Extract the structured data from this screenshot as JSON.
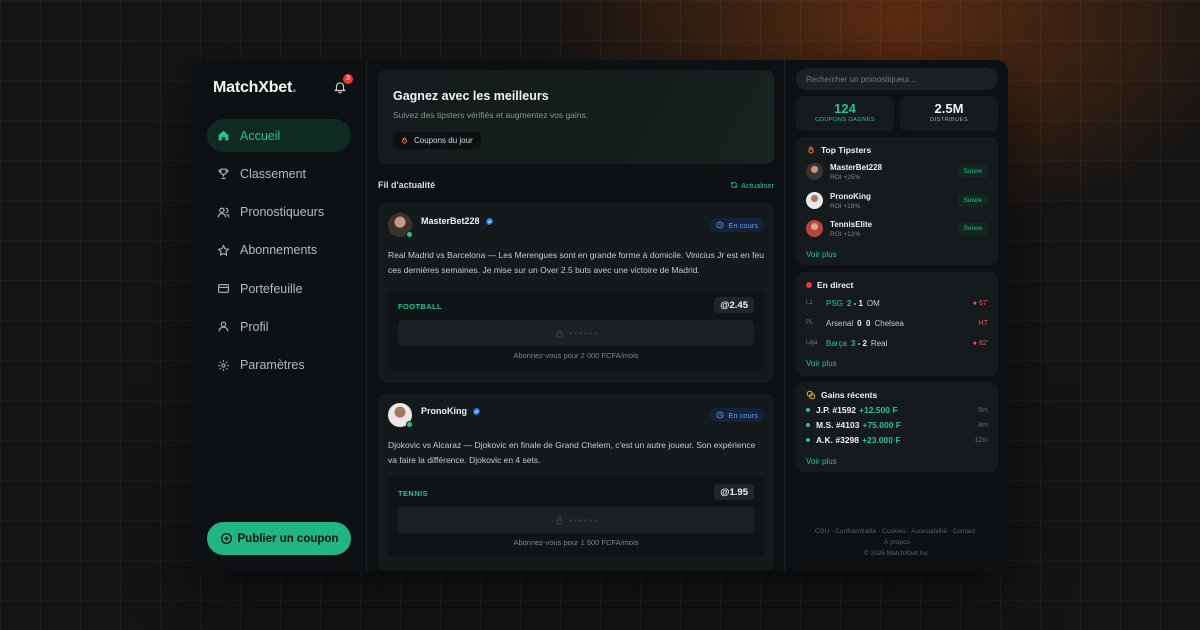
{
  "brand": {
    "name": "MatchXbet",
    "dot": "."
  },
  "notifications": {
    "count": "3"
  },
  "sidebar": {
    "items": [
      {
        "label": "Accueil",
        "icon": "home-icon"
      },
      {
        "label": "Classement",
        "icon": "trophy-icon"
      },
      {
        "label": "Pronostiqueurs",
        "icon": "users-icon"
      },
      {
        "label": "Abonnements",
        "icon": "star-icon"
      },
      {
        "label": "Portefeuille",
        "icon": "wallet-icon"
      },
      {
        "label": "Profil",
        "icon": "user-icon"
      },
      {
        "label": "Paramètres",
        "icon": "gear-icon"
      }
    ],
    "publish_label": "Publier un coupon"
  },
  "hero": {
    "title": "Gagnez avec les meilleurs",
    "subtitle": "Suivez des tipsters vérifiés et augmentez vos gains.",
    "pill": "Coupons du jour"
  },
  "feed": {
    "title": "Fil d'actualité",
    "refresh": "Actualiser",
    "posts": [
      {
        "author": "MasterBet228",
        "status": "En cours",
        "text": "Real Madrid vs Barcelona — Les Merengues sont en grande forme à domicile. Vinicius Jr est en feu ces dernières semaines. Je mise sur un Over 2.5 buts avec une victoire de Madrid.",
        "sport": "FOOTBALL",
        "odds": "@2.45",
        "locked": "• • • • • •",
        "subscribe": "Abonnez-vous pour 2 000 FCFA/mois"
      },
      {
        "author": "PronoKing",
        "status": "En cours",
        "text": "Djokovic vs Alcaraz — Djokovic en finale de Grand Chelem, c'est un autre joueur. Son expérience va faire la différence. Djokovic en 4 sets.",
        "sport": "TENNIS",
        "odds": "@1.95",
        "locked": "• • • • • •",
        "subscribe": "Abonnez-vous pour 1 500 FCFA/mois"
      }
    ]
  },
  "search": {
    "placeholder": "Rechercher un pronostiqueur..."
  },
  "stats": [
    {
      "value": "124",
      "label": "COUPONS GAGNÉS"
    },
    {
      "value": "2.5M",
      "label": "DISTRIBUÉS"
    }
  ],
  "top_tipsters": {
    "title": "Top Tipsters",
    "items": [
      {
        "name": "MasterBet228",
        "roi": "ROI +25%",
        "action": "Suivre"
      },
      {
        "name": "PronoKing",
        "roi": "ROI +18%",
        "action": "Suivre"
      },
      {
        "name": "TennisElite",
        "roi": "ROI +12%",
        "action": "Suivre"
      }
    ],
    "more": "Voir plus"
  },
  "live": {
    "title": "En direct",
    "matches": [
      {
        "league": "L1",
        "home": "PSG",
        "home_score": "2",
        "away_score": "1",
        "away": "OM",
        "minute": "● 67'"
      },
      {
        "league": "PL",
        "home": "Arsenal",
        "home_score": "0",
        "away_score": "0",
        "away": "Chelsea",
        "minute": "HT"
      },
      {
        "league": "Liga",
        "home": "Barça",
        "home_score": "3",
        "away_score": "2",
        "away": "Real",
        "minute": "● 82'"
      }
    ],
    "more": "Voir plus"
  },
  "recent_wins": {
    "title": "Gains récents",
    "items": [
      {
        "who": "J.P. #1592",
        "amount": "+12.500 F",
        "ago": "5m"
      },
      {
        "who": "M.S. #4103",
        "amount": "+75.000 F",
        "ago": "8m"
      },
      {
        "who": "A.K. #3298",
        "amount": "+23.000 F",
        "ago": "12m"
      }
    ],
    "more": "Voir plus"
  },
  "footer": {
    "links": "CGU · Confidentialité · Cookies · Accessibilité · Contact ·",
    "links2": "À propos",
    "copyright": "© 2026 MatchXbet Inc."
  },
  "colors": {
    "accent": "#22c38e",
    "live": "#e53935",
    "status": "#5e9dea"
  }
}
